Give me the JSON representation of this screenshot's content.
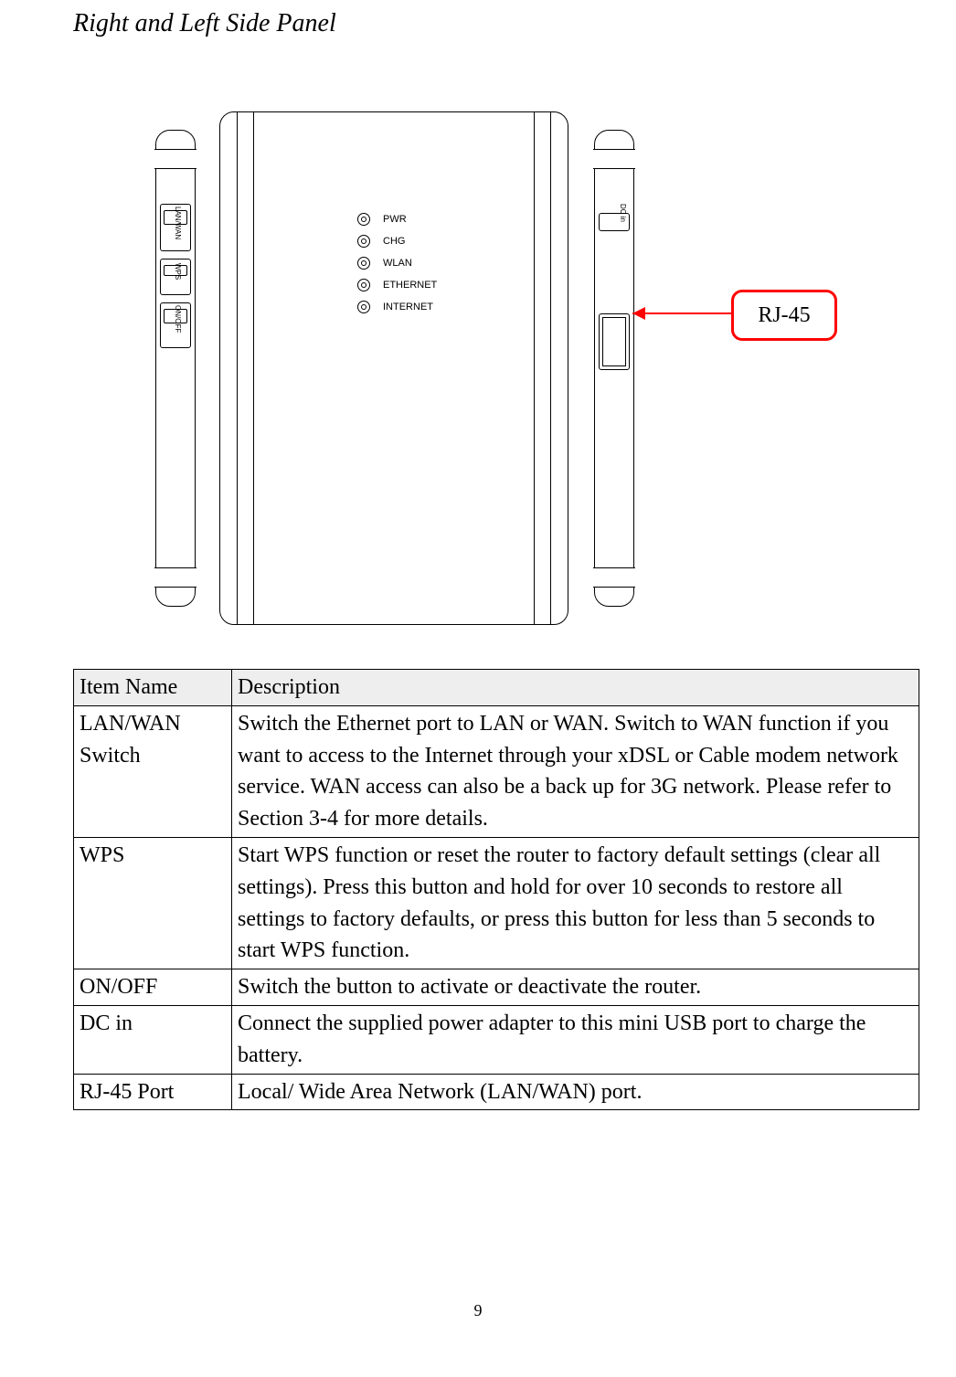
{
  "title": "Right and Left Side Panel",
  "diagram": {
    "leds": [
      "PWR",
      "CHG",
      "WLAN",
      "ETHERNET",
      "INTERNET"
    ],
    "left_labels": [
      "LAN/WAN",
      "WPS",
      "ON/OFF"
    ],
    "right_labels": [
      "DC in"
    ],
    "callout": "RJ-45"
  },
  "table": {
    "headers": [
      "Item Name",
      "Description"
    ],
    "rows": [
      {
        "item": "LAN/WAN Switch",
        "desc": "Switch the Ethernet port to LAN or WAN. Switch to WAN function if you want to access to the Internet through your xDSL or Cable modem network service. WAN access can also be a back up for 3G network. Please refer to Section 3-4 for more details."
      },
      {
        "item": "WPS",
        "desc": "Start WPS function or reset the router to factory default settings (clear all settings). Press this button and hold for over 10 seconds to restore all settings to factory defaults, or press this button for less than 5 seconds to start WPS function."
      },
      {
        "item": "ON/OFF",
        "desc": "Switch the button to activate or deactivate the router."
      },
      {
        "item": "DC in",
        "desc": "Connect the supplied power adapter to this mini USB port to charge the battery."
      },
      {
        "item": "RJ-45 Port",
        "desc": "Local/ Wide Area Network (LAN/WAN) port."
      }
    ]
  },
  "page_number": "9"
}
